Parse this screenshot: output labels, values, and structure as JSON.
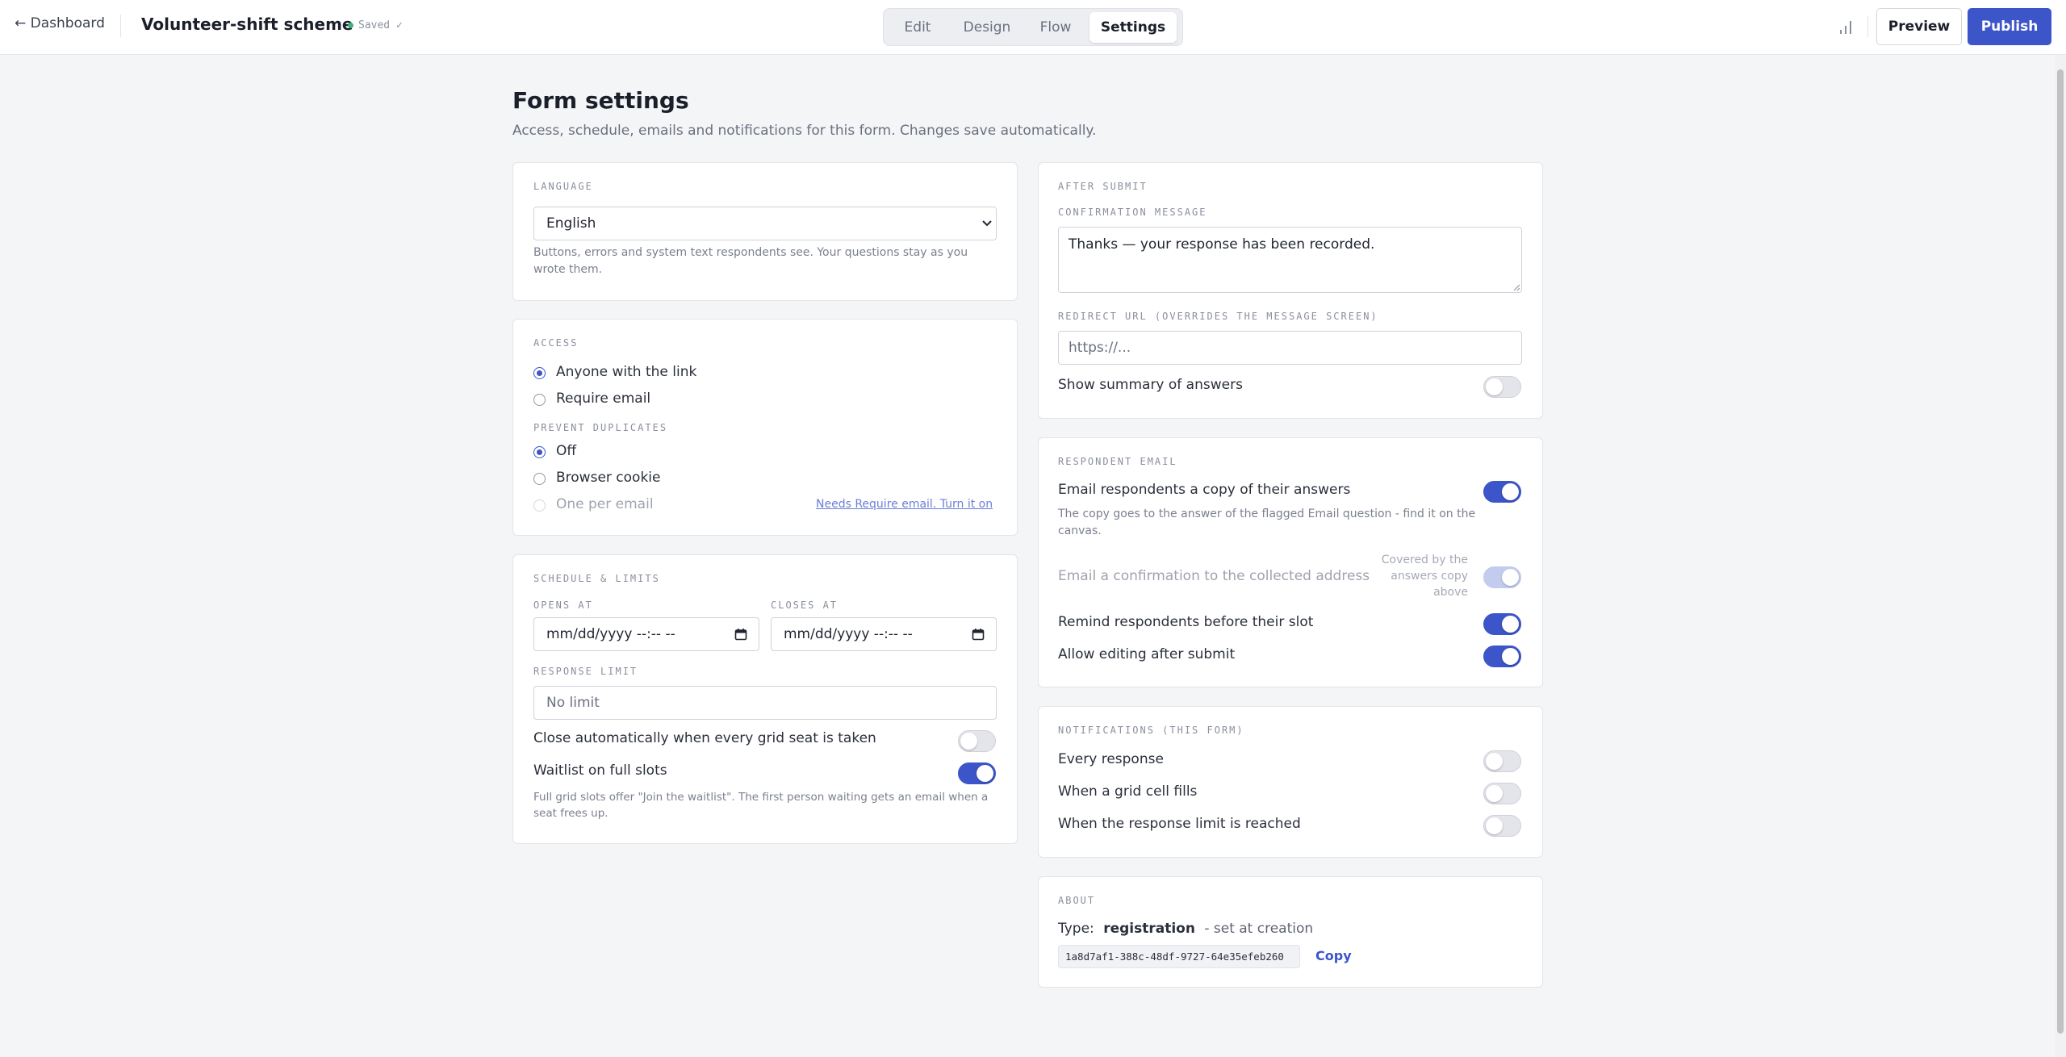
{
  "header": {
    "back_label": "← Dashboard",
    "form_title": "Volunteer-shift scheme",
    "saved_label": "Saved ✓",
    "tabs": [
      {
        "label": "Edit",
        "active": false
      },
      {
        "label": "Design",
        "active": false
      },
      {
        "label": "Flow",
        "active": false
      },
      {
        "label": "Settings",
        "active": true
      }
    ],
    "preview_label": "Preview",
    "publish_label": "Publish",
    "accent_color": "#3c55c9"
  },
  "page": {
    "title": "Form settings",
    "subtitle": "Access, schedule, emails and notifications for this form. Changes save automatically."
  },
  "language": {
    "section": "LANGUAGE",
    "selected": "English",
    "help": "Buttons, errors and system text respondents see. Your questions stay as you wrote them."
  },
  "access": {
    "section": "ACCESS",
    "options": [
      {
        "label": "Anyone with the link",
        "selected": true
      },
      {
        "label": "Require email",
        "selected": false
      }
    ],
    "duplicates_section": "PREVENT DUPLICATES",
    "duplicate_options": [
      {
        "label": "Off",
        "selected": true
      },
      {
        "label": "Browser cookie",
        "selected": false
      },
      {
        "label": "One per email",
        "selected": false,
        "disabled": true
      }
    ],
    "needs_link": "Needs Require email. Turn it on"
  },
  "schedule": {
    "section": "SCHEDULE & LIMITS",
    "opens_label": "OPENS AT",
    "opens_value": "mm/dd/yyyy --:-- --",
    "closes_label": "CLOSES AT",
    "closes_value": "mm/dd/yyyy --:-- --",
    "limit_label": "RESPONSE LIMIT",
    "limit_placeholder": "No limit",
    "close_auto_label": "Close automatically when every grid seat is taken",
    "close_auto_on": false,
    "waitlist_label": "Waitlist on full slots",
    "waitlist_on": true,
    "waitlist_help": "Full grid slots offer \"Join the waitlist\". The first person waiting gets an email when a seat frees up."
  },
  "after_submit": {
    "section": "AFTER SUBMIT",
    "confirmation_label": "CONFIRMATION MESSAGE",
    "confirmation_value": "Thanks — your response has been recorded.",
    "redirect_label": "REDIRECT URL (OVERRIDES THE MESSAGE SCREEN)",
    "redirect_placeholder": "https://...",
    "summary_label": "Show summary of answers",
    "summary_on": false
  },
  "respondent_email": {
    "section": "RESPONDENT EMAIL",
    "copy_label": "Email respondents a copy of their answers",
    "copy_on": true,
    "copy_help": "The copy goes to the answer of the flagged Email question - find it on the canvas.",
    "confirm_label": "Email a confirmation to the collected address",
    "confirm_note_line1": "Covered by the",
    "confirm_note_line2": "answers copy",
    "confirm_note_line3": "above",
    "confirm_on": true,
    "remind_label": "Remind respondents before their slot",
    "remind_on": true,
    "edit_label": "Allow editing after submit",
    "edit_on": true
  },
  "notifications": {
    "section": "NOTIFICATIONS (THIS FORM)",
    "items": [
      {
        "label": "Every response",
        "on": false
      },
      {
        "label": "When a grid cell fills",
        "on": false
      },
      {
        "label": "When the response limit is reached",
        "on": false
      }
    ]
  },
  "about": {
    "section": "ABOUT",
    "type_prefix": "Type:",
    "type_value": "registration",
    "type_suffix": "- set at creation",
    "form_id": "1a8d7af1-388c-48df-9727-64e35efeb260",
    "copy_label": "Copy"
  },
  "icons": {
    "stats": "bar-chart-icon",
    "calendar": "calendar-icon",
    "select": "chevron-down-icon"
  }
}
